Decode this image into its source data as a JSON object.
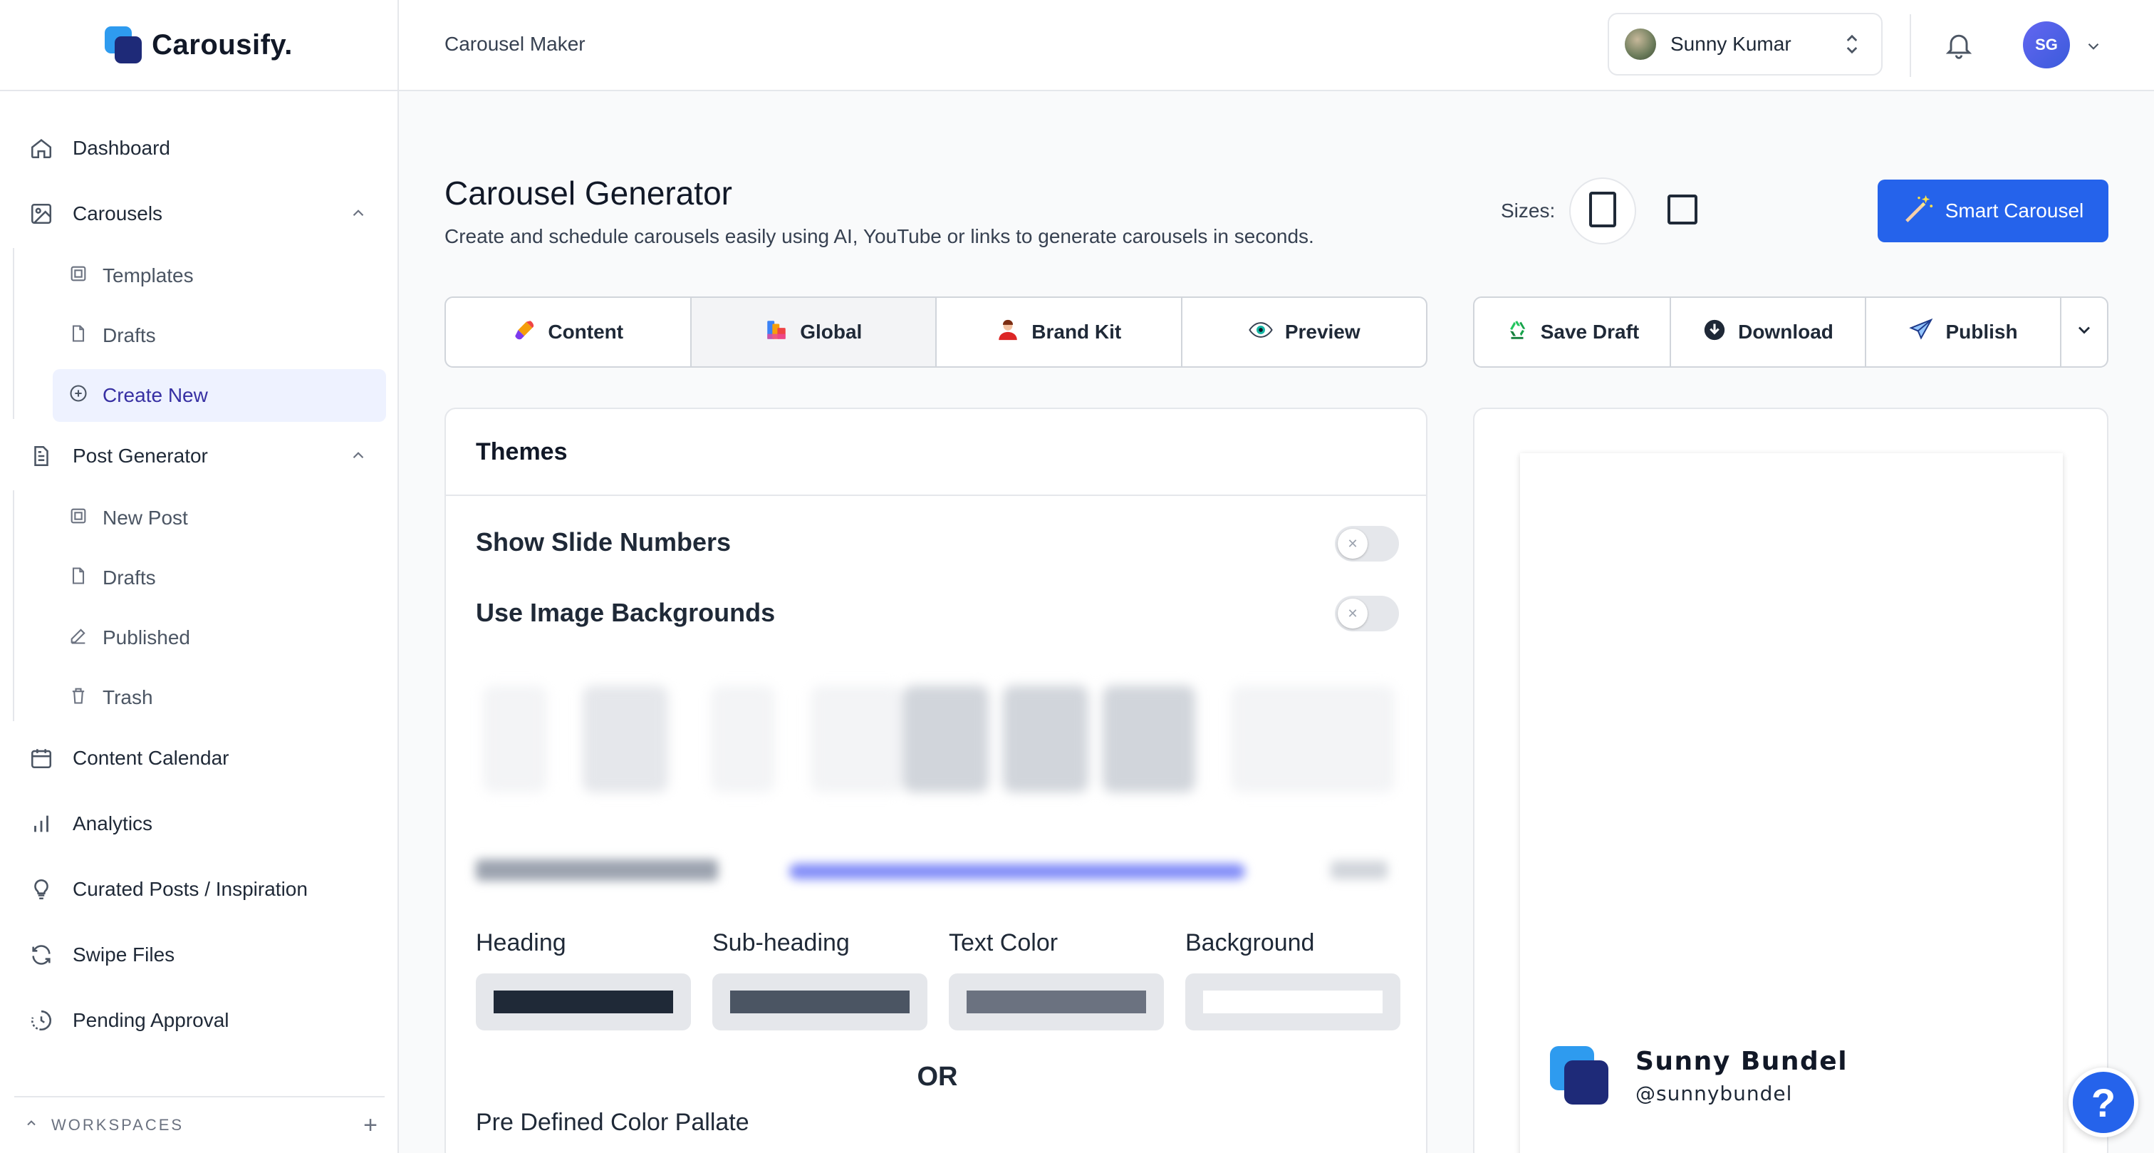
{
  "brand": {
    "name": "Carousify."
  },
  "header": {
    "title": "Carousel Maker",
    "user_name": "Sunny Kumar",
    "avatar_initials": "SG"
  },
  "sidebar": {
    "dashboard": "Dashboard",
    "carousels": "Carousels",
    "carousels_sub": [
      "Templates",
      "Drafts",
      "Create New"
    ],
    "post_generator": "Post Generator",
    "post_sub": [
      "New Post",
      "Drafts",
      "Published",
      "Trash"
    ],
    "content_calendar": "Content Calendar",
    "analytics": "Analytics",
    "curated": "Curated Posts / Inspiration",
    "swipe": "Swipe Files",
    "pending": "Pending Approval",
    "workspaces": "WORKSPACES"
  },
  "main": {
    "title": "Carousel Generator",
    "subtitle": "Create and schedule carousels easily using AI, YouTube or links to generate carousels in seconds.",
    "sizes_label": "Sizes:",
    "smart_button": "Smart Carousel",
    "tabs": [
      "Content",
      "Global",
      "Brand Kit",
      "Preview"
    ],
    "active_tab": "Global",
    "actions": [
      "Save Draft",
      "Download",
      "Publish"
    ]
  },
  "themes": {
    "title": "Themes",
    "show_slide_numbers": "Show Slide Numbers",
    "show_slide_numbers_on": false,
    "use_image_backgrounds": "Use Image Backgrounds",
    "use_image_backgrounds_on": false,
    "colors": [
      {
        "label": "Heading",
        "value": "#1f2937"
      },
      {
        "label": "Sub-heading",
        "value": "#4b5563"
      },
      {
        "label": "Text Color",
        "value": "#6b7280"
      },
      {
        "label": "Background",
        "value": "#ffffff"
      }
    ],
    "or": "OR",
    "predefined": "Pre Defined Color Pallate"
  },
  "preview": {
    "name": "Sunny Bundel",
    "handle": "@sunnybundel"
  },
  "help": "?",
  "colors": {
    "accent": "#2563eb",
    "brand_light": "#2e9bef",
    "brand_dark": "#1e2a78"
  }
}
